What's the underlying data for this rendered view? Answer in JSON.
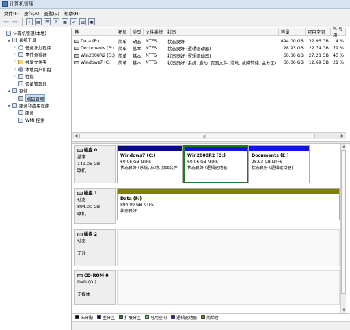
{
  "window": {
    "title": "计算机管理"
  },
  "menu": [
    "文件(F)",
    "操作(A)",
    "查看(V)",
    "帮助(H)"
  ],
  "tree": [
    {
      "label": "计算机管理(本地)",
      "level": 0,
      "icon": "computer-icon",
      "expander": "",
      "selected": false
    },
    {
      "label": "系统工具",
      "level": 1,
      "icon": "tools-icon",
      "expander": "◢",
      "selected": false
    },
    {
      "label": "任务计划程序",
      "level": 2,
      "icon": "clock-icon",
      "expander": "▷",
      "selected": false
    },
    {
      "label": "事件查看器",
      "level": 2,
      "icon": "event-viewer-icon",
      "expander": "▷",
      "selected": false
    },
    {
      "label": "共享文件夹",
      "level": 2,
      "icon": "folder-icon",
      "expander": "▷",
      "selected": false
    },
    {
      "label": "本地用户和组",
      "level": 2,
      "icon": "users-icon",
      "expander": "▷",
      "selected": false
    },
    {
      "label": "性能",
      "level": 2,
      "icon": "performance-icon",
      "expander": "▷",
      "selected": false
    },
    {
      "label": "设备管理器",
      "level": 2,
      "icon": "device-manager-icon",
      "expander": "",
      "selected": false
    },
    {
      "label": "存储",
      "level": 1,
      "icon": "storage-icon",
      "expander": "◢",
      "selected": false
    },
    {
      "label": "磁盘管理",
      "level": 2,
      "icon": "disk-management-icon",
      "expander": "",
      "selected": true
    },
    {
      "label": "服务和应用程序",
      "level": 1,
      "icon": "services-apps-icon",
      "expander": "◢",
      "selected": false
    },
    {
      "label": "服务",
      "level": 2,
      "icon": "services-icon",
      "expander": "",
      "selected": false
    },
    {
      "label": "WMI 控件",
      "level": 2,
      "icon": "wmi-icon",
      "expander": "",
      "selected": false
    }
  ],
  "volumes": {
    "headers": [
      "卷",
      "布局",
      "类型",
      "文件系统",
      "状态",
      "容量",
      "可用空间",
      "% 可用"
    ],
    "rows": [
      [
        "Data (F:)",
        "简单",
        "动态",
        "NTFS",
        "状态良好",
        "894.00 GB",
        "32.96 GB",
        "4 %"
      ],
      [
        "Documents (E:)",
        "简单",
        "基本",
        "NTFS",
        "状态良好 (逻辑驱动器)",
        "28.93 GB",
        "22.74 GB",
        "79 %"
      ],
      [
        "Win2008R2 (D:)",
        "简单",
        "基本",
        "NTFS",
        "状态良好 (逻辑驱动器)",
        "60.06 GB",
        "27.28 GB",
        "45 %"
      ],
      [
        "Windows7 (C:)",
        "简单",
        "基本",
        "NTFS",
        "状态良好 (系统, 启动, 页面文件, 活动, 故障转储, 主分区)",
        "60.06 GB",
        "12.69 GB",
        "21 %"
      ]
    ]
  },
  "disks": [
    {
      "name": "磁盘 0",
      "type": "基本",
      "size": "149.05 GB",
      "status": "联机",
      "partitions": [
        {
          "name": "Windows7  (C:)",
          "detail": "60.06 GB NTFS",
          "status": "状态良好 (系统, 启动, 页面文件",
          "color": "#0a0a80",
          "selected": false
        },
        {
          "name": "Win2008R2  (D:)",
          "detail": "60.06 GB NTFS",
          "status": "状态良好 (逻辑驱动器)",
          "color": "#1414e6",
          "selected": true
        },
        {
          "name": "Documents  (E:)",
          "detail": "28.93 GB NTFS",
          "status": "状态良好 (逻辑驱动器)",
          "color": "#1414e6",
          "selected": false
        }
      ]
    },
    {
      "name": "磁盘 1",
      "type": "动态",
      "size": "894.00 GB",
      "status": "联机",
      "partitions": [
        {
          "name": "Data  (F:)",
          "detail": "894.00 GB NTFS",
          "status": "状态良好",
          "color": "#808000",
          "selected": false
        }
      ]
    },
    {
      "name": "磁盘 2",
      "type": "动态",
      "size": "",
      "status": "无效",
      "partitions": []
    },
    {
      "name": "CD-ROM 0",
      "type": "DVD (O:)",
      "size": "",
      "status": "无媒体",
      "partitions": []
    }
  ],
  "legend": [
    {
      "label": "未分配",
      "color": "#000000"
    },
    {
      "label": "主分区",
      "color": "#0a0a80"
    },
    {
      "label": "扩展分区",
      "color": "#1a8a1a"
    },
    {
      "label": "可用空间",
      "color": "#66e066"
    },
    {
      "label": "逻辑驱动器",
      "color": "#1414e6"
    },
    {
      "label": "简单卷",
      "color": "#808000"
    }
  ],
  "scroll": {
    "grip": "III"
  }
}
